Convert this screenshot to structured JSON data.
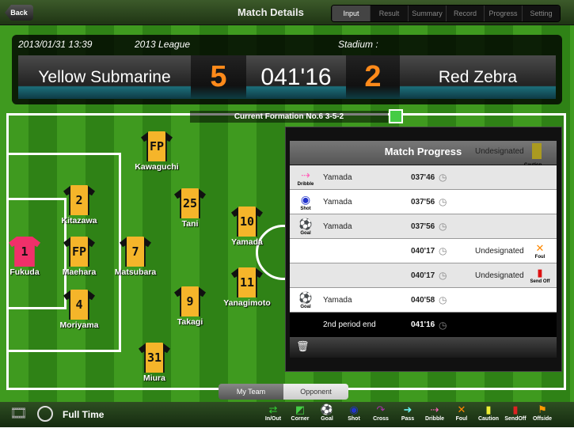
{
  "header": {
    "back_label": "Back",
    "title": "Match Details",
    "tabs": [
      "Input",
      "Result",
      "Summary",
      "Record",
      "Progress",
      "Setting"
    ],
    "active_tab": "Input"
  },
  "match": {
    "datetime": "2013/01/31 13:39",
    "competition": "2013 League",
    "stadium_label": "Stadium :",
    "home_team": "Yellow Submarine",
    "home_score": "5",
    "clock": "041'16",
    "away_score": "2",
    "away_team": "Red Zebra"
  },
  "formation": {
    "label": "Current Formation No.6  3-5-2"
  },
  "players": [
    {
      "num": "FP",
      "name": "Kawaguchi",
      "gk": false
    },
    {
      "num": "2",
      "name": "Kitazawa",
      "gk": false
    },
    {
      "num": "25",
      "name": "Tani",
      "gk": false
    },
    {
      "num": "10",
      "name": "Yamada",
      "gk": false
    },
    {
      "num": "1",
      "name": "Fukuda",
      "gk": true
    },
    {
      "num": "FP",
      "name": "Maehara",
      "gk": false
    },
    {
      "num": "7",
      "name": "Matsubara",
      "gk": false
    },
    {
      "num": "11",
      "name": "Yanagimoto",
      "gk": false
    },
    {
      "num": "4",
      "name": "Moriyama",
      "gk": false
    },
    {
      "num": "9",
      "name": "Takagi",
      "gk": false
    },
    {
      "num": "31",
      "name": "Miura",
      "gk": false
    }
  ],
  "progress": {
    "title": "Match Progress",
    "partial_row": {
      "player": "Undesignated",
      "event": "Caution"
    },
    "rows": [
      {
        "event": "Dribble",
        "player": "Yamada",
        "time": "037'46",
        "target": "",
        "result": ""
      },
      {
        "event": "Shot",
        "player": "Yamada",
        "time": "037'56",
        "target": "",
        "result": ""
      },
      {
        "event": "Goal",
        "player": "Yamada",
        "time": "037'56",
        "target": "",
        "result": ""
      },
      {
        "event": "",
        "player": "",
        "time": "040'17",
        "target": "Undesignated",
        "result": "Foul"
      },
      {
        "event": "",
        "player": "",
        "time": "040'17",
        "target": "Undesignated",
        "result": "Send Off"
      },
      {
        "event": "Goal",
        "player": "Yamada",
        "time": "040'58",
        "target": "",
        "result": ""
      }
    ],
    "period_row": {
      "label": "2nd period end",
      "time": "041'16"
    }
  },
  "team_toggle": {
    "options": [
      "My Team",
      "Opponent"
    ],
    "selected": "My Team"
  },
  "toolbar": {
    "status": "Full Time",
    "actions": [
      "In/Out",
      "Corner",
      "Goal",
      "Shot",
      "Cross",
      "Pass",
      "Dribble",
      "Foul",
      "Caution",
      "SendOff",
      "Offside"
    ]
  }
}
